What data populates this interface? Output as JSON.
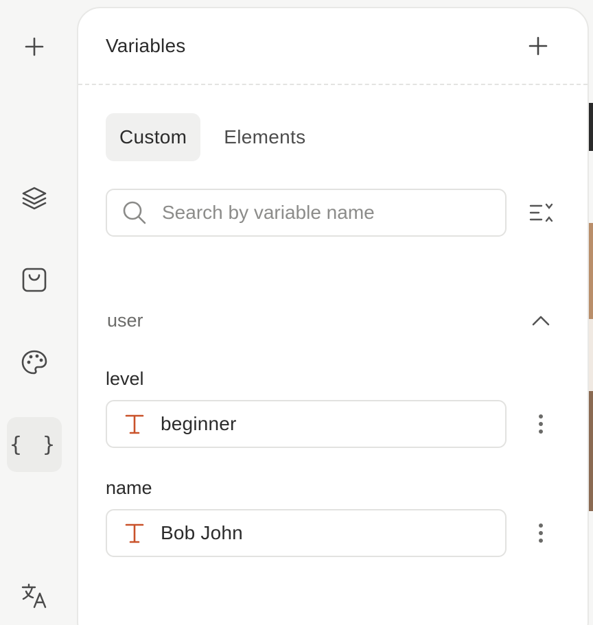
{
  "rail": {
    "items": [
      {
        "icon": "plus-icon",
        "label": "add"
      },
      {
        "icon": "layers-icon",
        "label": "layers"
      },
      {
        "icon": "bag-icon",
        "label": "assets"
      },
      {
        "icon": "palette-icon",
        "label": "theme"
      },
      {
        "icon": "braces-icon",
        "label": "variables",
        "glyph": "{ }",
        "active": true
      },
      {
        "icon": "translate-icon",
        "label": "translations"
      }
    ]
  },
  "panel": {
    "title": "Variables",
    "tabs": [
      {
        "label": "Custom",
        "active": true
      },
      {
        "label": "Elements",
        "active": false
      }
    ],
    "search": {
      "placeholder": "Search by variable name",
      "value": ""
    },
    "groups": [
      {
        "name": "user",
        "expanded": true,
        "variables": [
          {
            "name": "level",
            "type": "text",
            "value": "beginner"
          },
          {
            "name": "name",
            "type": "text",
            "value": "Bob John"
          }
        ]
      }
    ]
  },
  "colors": {
    "text_type_icon": "#c9522a",
    "active_bg": "#f0f0ef",
    "border": "#e2e2e0"
  }
}
